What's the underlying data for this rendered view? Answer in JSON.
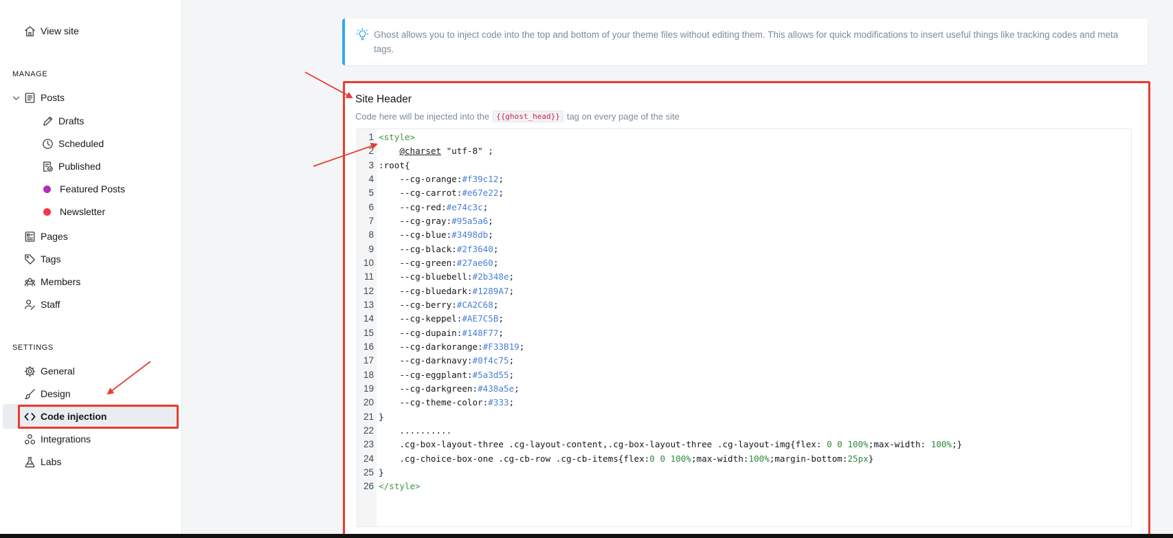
{
  "sidebar": {
    "view_site": "View site",
    "manage_label": "MANAGE",
    "posts": "Posts",
    "post_sub": [
      {
        "label": "Drafts",
        "icon": "pencil-icon"
      },
      {
        "label": "Scheduled",
        "icon": "clock-icon"
      },
      {
        "label": "Published",
        "icon": "published-icon"
      },
      {
        "label": "Featured Posts",
        "icon": "dot",
        "color": "#b12fbb"
      },
      {
        "label": "Newsletter",
        "icon": "dot",
        "color": "#f2364d"
      }
    ],
    "pages": "Pages",
    "tags": "Tags",
    "members": "Members",
    "staff": "Staff",
    "settings_label": "SETTINGS",
    "general": "General",
    "design": "Design",
    "code_injection": "Code injection",
    "integrations": "Integrations",
    "labs": "Labs"
  },
  "info": {
    "text": "Ghost allows you to inject code into the top and bottom of your theme files without editing them. This allows for quick modifications to insert useful things like tracking codes and meta tags."
  },
  "site_header": {
    "title": "Site Header",
    "desc_before": "Code here will be injected into the",
    "desc_code": "{{ghost_head}}",
    "desc_after": "tag on every page of the site"
  },
  "colors": {
    "accent": "#30a7f0",
    "highlight": "#ea3b2f"
  },
  "code_lines": [
    [
      {
        "t": "<style>",
        "c": "tag"
      }
    ],
    [
      {
        "t": "    "
      },
      {
        "t": "@charset",
        "c": "kw"
      },
      {
        "t": " \"utf-8\" ;",
        "c": "str"
      }
    ],
    [
      {
        "t": ":root{"
      }
    ],
    [
      {
        "t": "    --cg-orange:"
      },
      {
        "t": "#f39c12",
        "c": "val"
      },
      {
        "t": ";"
      }
    ],
    [
      {
        "t": "    --cg-carrot:"
      },
      {
        "t": "#e67e22",
        "c": "val"
      },
      {
        "t": ";"
      }
    ],
    [
      {
        "t": "    --cg-red:"
      },
      {
        "t": "#e74c3c",
        "c": "val"
      },
      {
        "t": ";"
      }
    ],
    [
      {
        "t": "    --cg-gray:"
      },
      {
        "t": "#95a5a6",
        "c": "val"
      },
      {
        "t": ";"
      }
    ],
    [
      {
        "t": "    --cg-blue:"
      },
      {
        "t": "#3498db",
        "c": "val"
      },
      {
        "t": ";"
      }
    ],
    [
      {
        "t": "    --cg-black:"
      },
      {
        "t": "#2f3640",
        "c": "val"
      },
      {
        "t": ";"
      }
    ],
    [
      {
        "t": "    --cg-green:"
      },
      {
        "t": "#27ae60",
        "c": "val"
      },
      {
        "t": ";"
      }
    ],
    [
      {
        "t": "    --cg-bluebell:"
      },
      {
        "t": "#2b348e",
        "c": "val"
      },
      {
        "t": ";"
      }
    ],
    [
      {
        "t": "    --cg-bluedark:"
      },
      {
        "t": "#1289A7",
        "c": "val"
      },
      {
        "t": ";"
      }
    ],
    [
      {
        "t": "    --cg-berry:"
      },
      {
        "t": "#CA2C68",
        "c": "val"
      },
      {
        "t": ";"
      }
    ],
    [
      {
        "t": "    --cg-keppel:"
      },
      {
        "t": "#AE7C5B",
        "c": "val"
      },
      {
        "t": ";"
      }
    ],
    [
      {
        "t": "    --cg-dupain:"
      },
      {
        "t": "#148F77",
        "c": "val"
      },
      {
        "t": ";"
      }
    ],
    [
      {
        "t": "    --cg-darkorange:"
      },
      {
        "t": "#F33B19",
        "c": "val"
      },
      {
        "t": ";"
      }
    ],
    [
      {
        "t": "    --cg-darknavy:"
      },
      {
        "t": "#0f4c75",
        "c": "val"
      },
      {
        "t": ";"
      }
    ],
    [
      {
        "t": "    --cg-eggplant:"
      },
      {
        "t": "#5a3d55",
        "c": "val"
      },
      {
        "t": ";"
      }
    ],
    [
      {
        "t": "    --cg-darkgreen:"
      },
      {
        "t": "#438a5e",
        "c": "val"
      },
      {
        "t": ";"
      }
    ],
    [
      {
        "t": "    --cg-theme-color:"
      },
      {
        "t": "#333",
        "c": "val"
      },
      {
        "t": ";"
      }
    ],
    [
      {
        "t": "}"
      }
    ],
    [
      {
        "t": "    .........."
      }
    ],
    [
      {
        "t": "    .cg-box-layout-three .cg-layout-content,.cg-box-layout-three .cg-layout-img{flex: "
      },
      {
        "t": "0 0 100%",
        "c": "num"
      },
      {
        "t": ";max-width: "
      },
      {
        "t": "100%",
        "c": "num"
      },
      {
        "t": ";}"
      }
    ],
    [
      {
        "t": "    .cg-choice-box-one .cg-cb-row .cg-cb-items{flex:"
      },
      {
        "t": "0 0 100%",
        "c": "num"
      },
      {
        "t": ";max-width:"
      },
      {
        "t": "100%",
        "c": "num"
      },
      {
        "t": ";margin-bottom:"
      },
      {
        "t": "25px",
        "c": "num"
      },
      {
        "t": "}"
      }
    ],
    [
      {
        "t": "}"
      }
    ],
    [
      {
        "t": "</style>",
        "c": "tag"
      }
    ]
  ]
}
